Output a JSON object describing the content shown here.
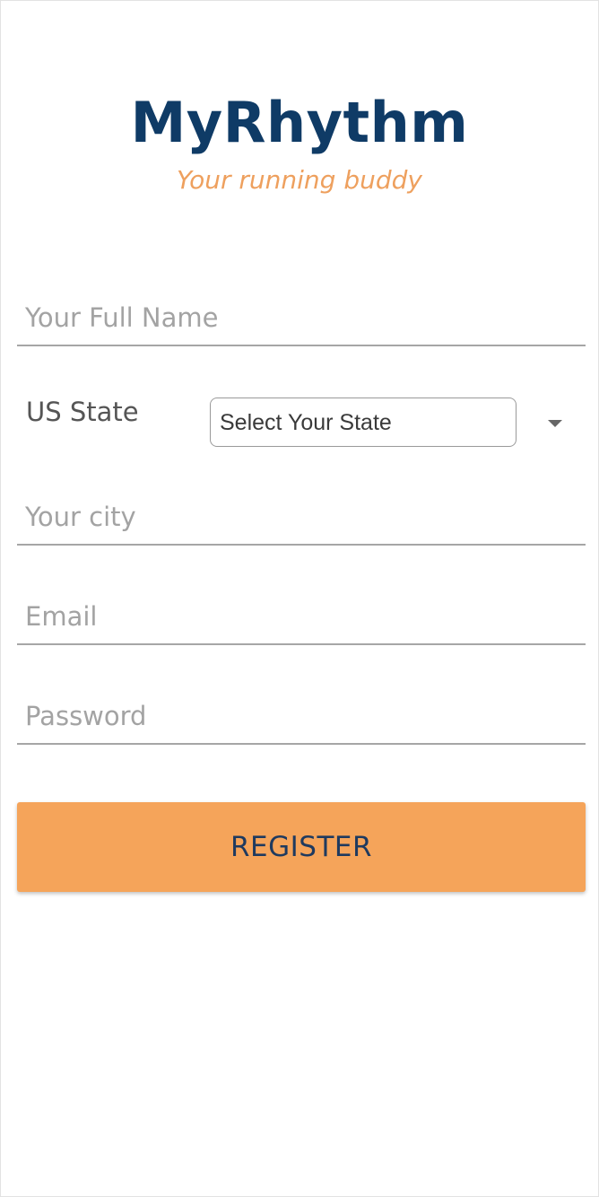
{
  "colors": {
    "brand_navy": "#0f3b66",
    "accent_orange": "#f5a45a",
    "tagline_orange": "#eea05e",
    "label_gray": "#555555",
    "button_text": "#1f3a5f"
  },
  "header": {
    "app_title": "MyRhythm",
    "tagline": "Your running buddy"
  },
  "form": {
    "full_name": {
      "value": "",
      "placeholder": "Your Full Name"
    },
    "state": {
      "label": "US State",
      "selected": "Select Your State",
      "icon": "caret-down-icon"
    },
    "city": {
      "value": "",
      "placeholder": "Your city"
    },
    "email": {
      "value": "",
      "placeholder": "Email"
    },
    "password": {
      "value": "",
      "placeholder": "Password"
    },
    "register_label": "REGISTER"
  }
}
